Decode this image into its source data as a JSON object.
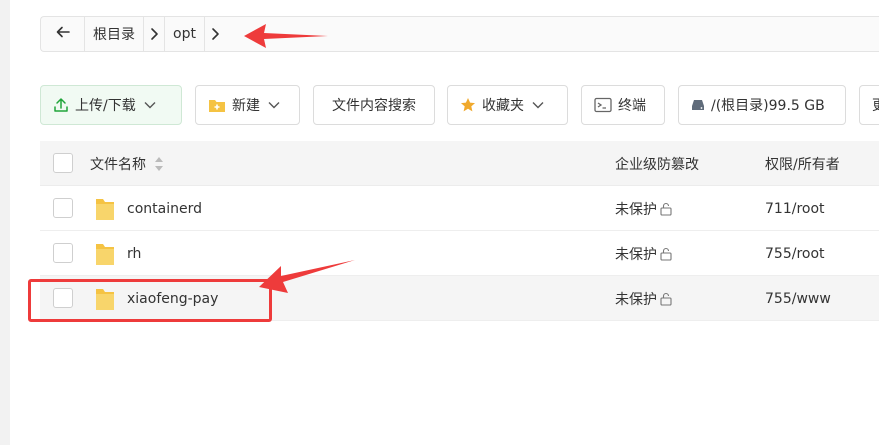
{
  "breadcrumb": {
    "items": [
      {
        "label": "根目录"
      },
      {
        "label": "opt"
      }
    ]
  },
  "toolbar": {
    "upload_download": "上传/下载",
    "new": "新建",
    "search_content": "文件内容搜索",
    "favorites": "收藏夹",
    "terminal": "终端",
    "disk": "/(根目录)99.5 GB",
    "cut_off": "更"
  },
  "table": {
    "headers": {
      "name": "文件名称",
      "tamper": "企业级防篡改",
      "perm": "权限/所有者"
    },
    "rows": [
      {
        "name": "containerd",
        "tamper": "未保护",
        "perm": "711/root"
      },
      {
        "name": "rh",
        "tamper": "未保护",
        "perm": "755/root"
      },
      {
        "name": "xiaofeng-pay",
        "tamper": "未保护",
        "perm": "755/www"
      }
    ]
  },
  "colors": {
    "accent_green": "#20a53a",
    "annotation_red": "#ee3b3b",
    "folder_yellow": "#f5c343"
  }
}
